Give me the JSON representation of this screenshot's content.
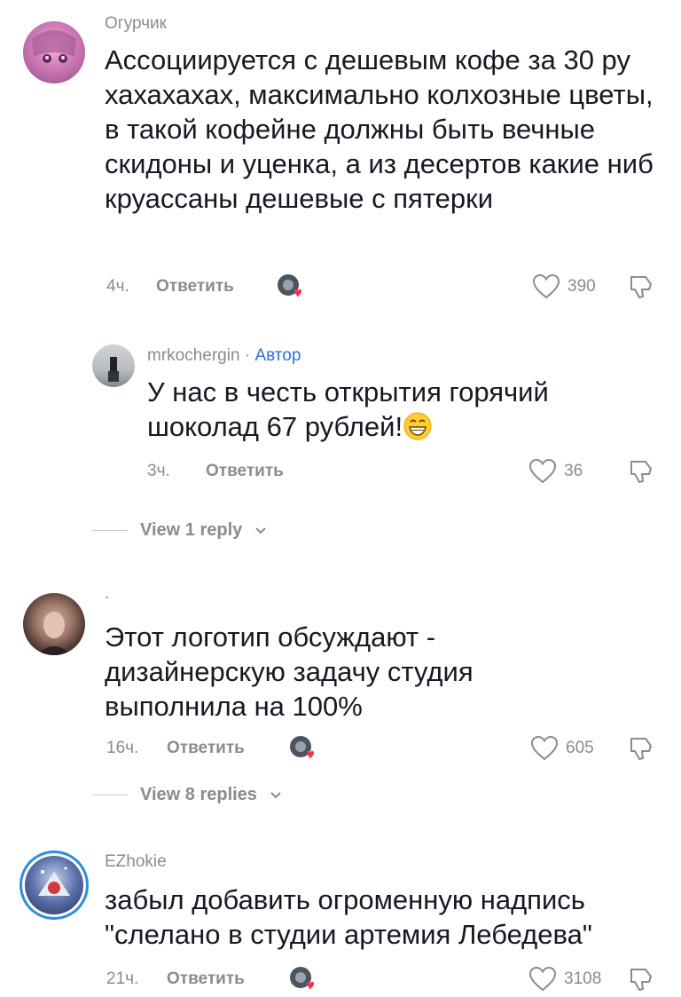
{
  "comments": [
    {
      "username": "Огурчик",
      "text": "Ассоциируется с дешевым кофе за 30 ру хахахахах, максимально колхозные цветы, в такой кофейне должны быть вечные скидоны и уценка, а из десертов какие ниб круассаны дешевые с пятерки",
      "time": "4ч.",
      "reply_label": "Ответить",
      "likes": "390"
    },
    {
      "username": "mrkochergin",
      "separator": " · ",
      "author_label": "Автор",
      "text": "У нас в честь открытия горячий шоколад 67 рублей!",
      "time": "3ч.",
      "reply_label": "Ответить",
      "likes": "36",
      "view_replies": "View 1 reply"
    },
    {
      "username": ".",
      "text": "Этот логотип обсуждают - дизайнерскую задачу студия выполнила на 100%",
      "time": "16ч.",
      "reply_label": "Ответить",
      "likes": "605",
      "view_replies": "View 8 replies"
    },
    {
      "username": "EZhokie",
      "text": "забыл добавить огроменную надпись \"слелано в студии артемия Лебедева\"",
      "time": "21ч.",
      "reply_label": "Ответить",
      "likes": "3108"
    }
  ],
  "icons": {
    "like": "heart-outline-icon",
    "dislike": "thumbs-down-icon",
    "creator_liked": "creator-liked-icon",
    "emoji": "grinning-face-emoji"
  },
  "colors": {
    "text": "#161823",
    "secondary": "#8a8b91",
    "author": "#2b6fd6"
  }
}
